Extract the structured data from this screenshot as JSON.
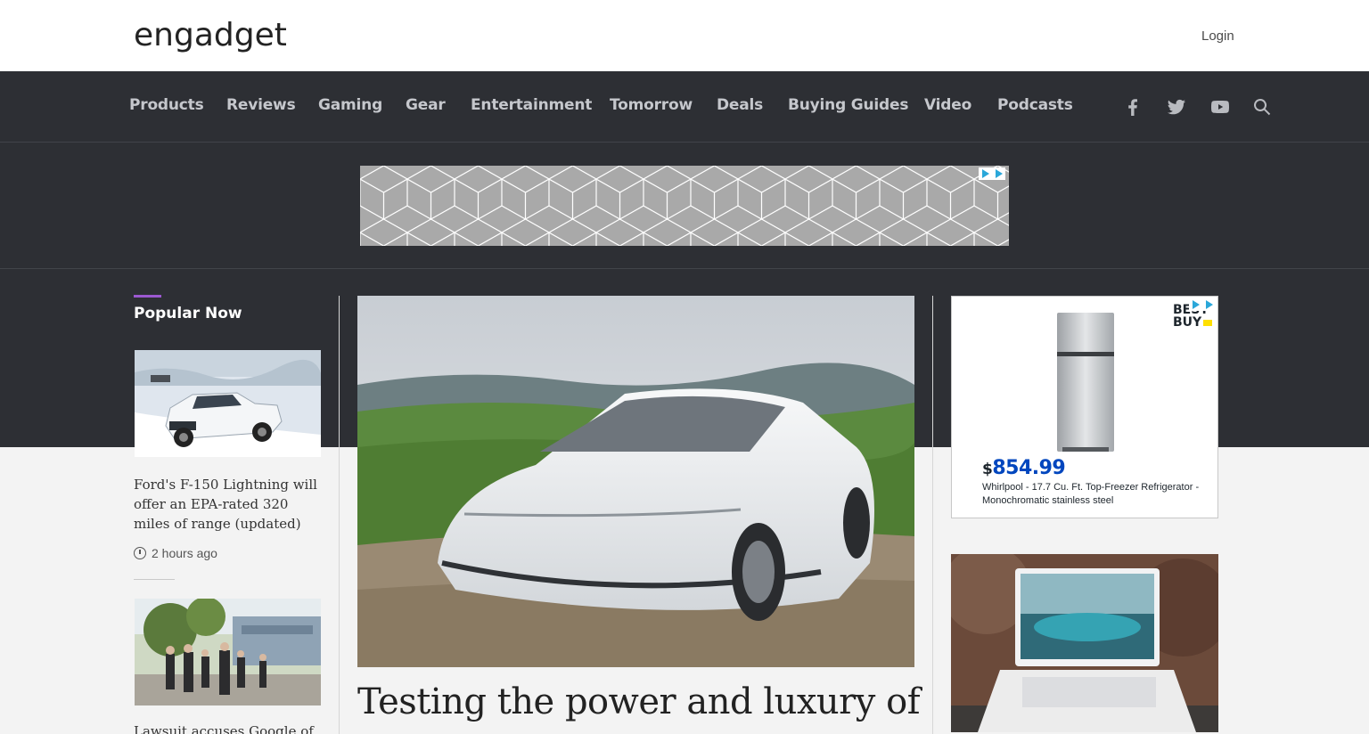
{
  "header": {
    "logo": "engadget",
    "login_label": "Login"
  },
  "nav": {
    "items": [
      {
        "label": "Products"
      },
      {
        "label": "Reviews"
      },
      {
        "label": "Gaming"
      },
      {
        "label": "Gear"
      },
      {
        "label": "Entertainment"
      },
      {
        "label": "Tomorrow"
      },
      {
        "label": "Deals"
      },
      {
        "label": "Buying Guides"
      },
      {
        "label": "Video"
      },
      {
        "label": "Podcasts"
      }
    ],
    "icons": [
      "facebook-icon",
      "twitter-icon",
      "youtube-icon",
      "search-icon"
    ]
  },
  "popular": {
    "heading": "Popular Now",
    "stories": [
      {
        "title": "Ford's F-150 Lightning will offer an EPA-rated 320 miles of range (updated)",
        "time": "2 hours ago"
      },
      {
        "title": "Lawsuit accuses Google of"
      }
    ]
  },
  "hero": {
    "title": "Testing the power and luxury of"
  },
  "right_ad": {
    "brand": "BEST BUY",
    "currency": "$",
    "price": "854.99",
    "description": "Whirlpool - 17.7 Cu. Ft. Top-Freezer Refrigerator - Monochromatic stainless steel"
  },
  "colors": {
    "header_bg": "#ffffff",
    "nav_bg": "#2d2f34",
    "accent": "#9b59d0",
    "page_bg": "#f3f3f3",
    "price_blue": "#0046be"
  }
}
